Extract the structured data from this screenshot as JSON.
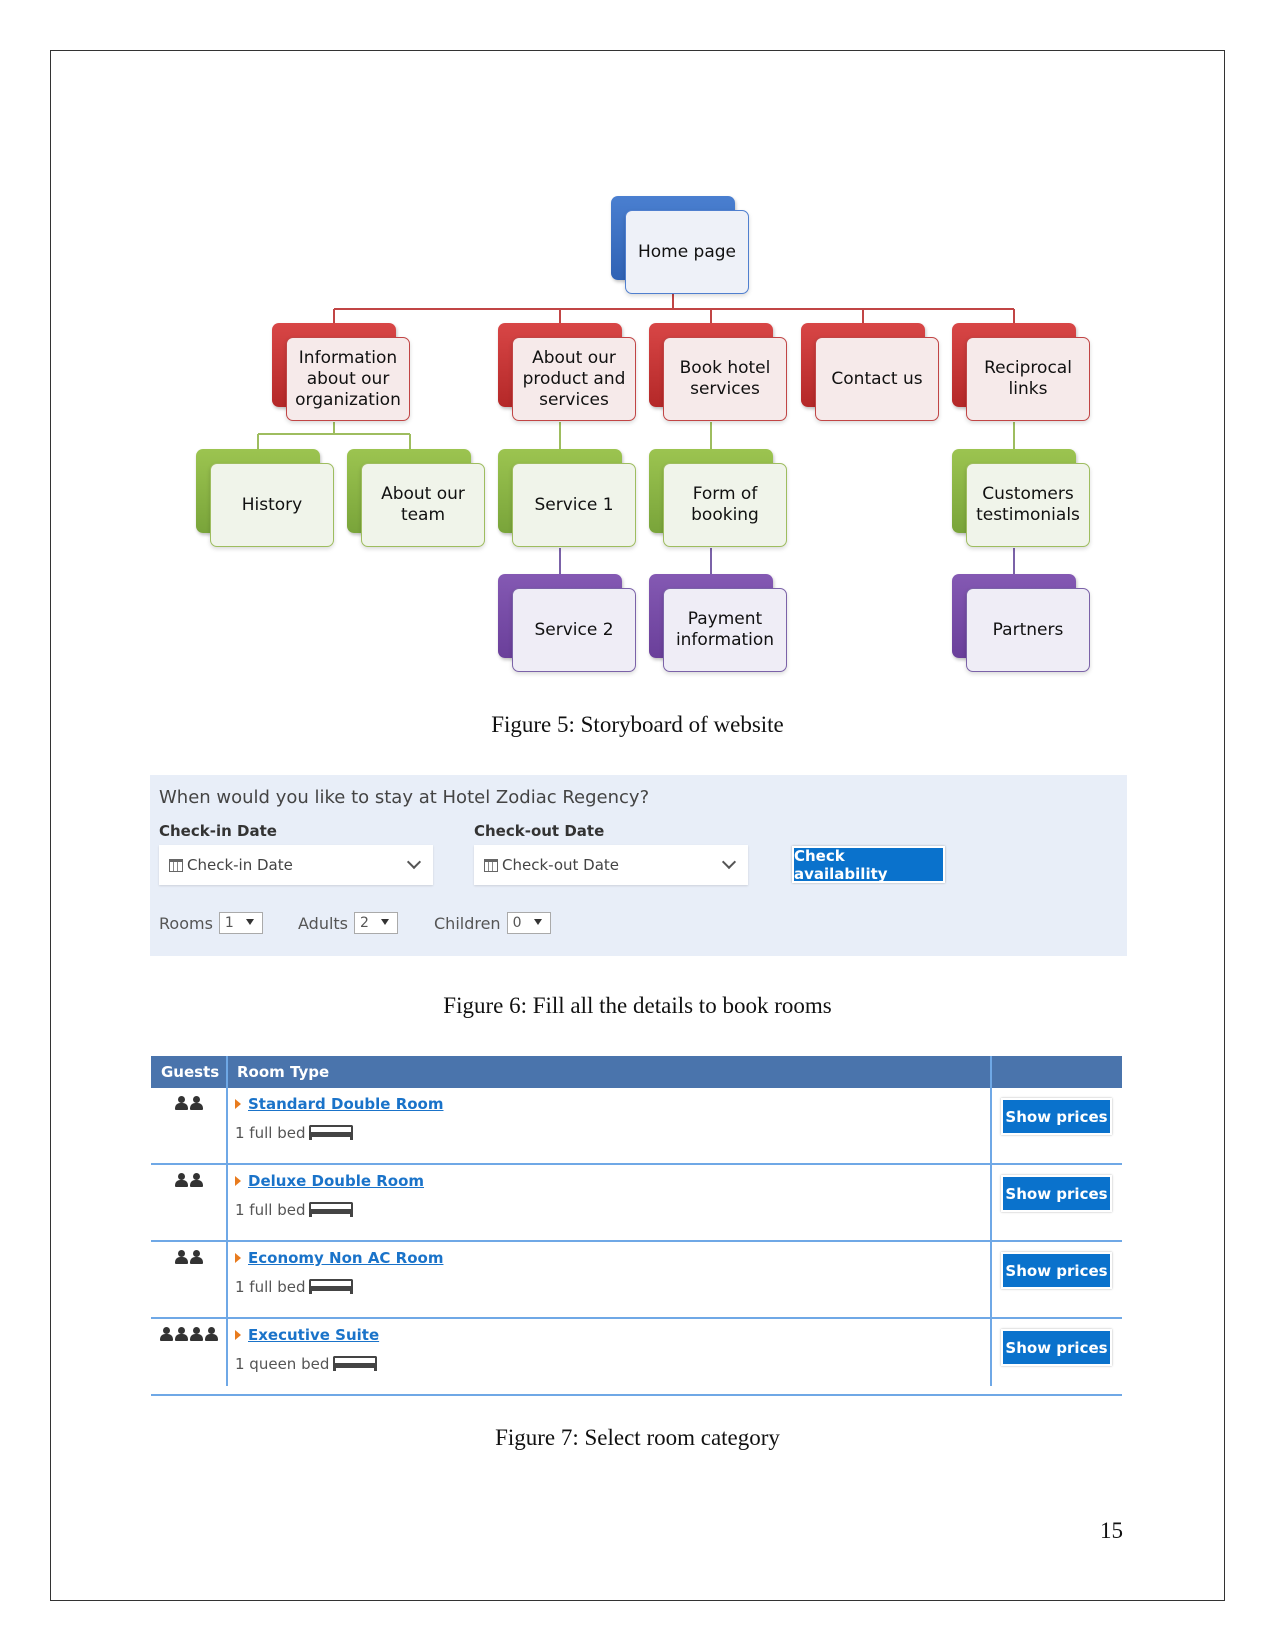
{
  "storyboard": {
    "nodes": {
      "home": "Home page",
      "info": "Information about our organization",
      "about_product": "About our product and services",
      "book": "Book hotel services",
      "contact": "Contact us",
      "reciprocal": "Reciprocal links",
      "history": "History",
      "about_team": "About our team",
      "service1": "Service 1",
      "form_booking": "Form of booking",
      "customers": "Customers testimonials",
      "service2": "Service 2",
      "payment": "Payment information",
      "partners": "Partners"
    },
    "colors": {
      "level1": "#3a6ec4",
      "level2": "#c73636",
      "level3": "#8bb445",
      "level4": "#7a4fab"
    }
  },
  "captions": {
    "fig5": "Figure 5: Storyboard of website",
    "fig6": "Figure 6: Fill all the details to book rooms",
    "fig7": "Figure 7: Select room category"
  },
  "booking": {
    "question": "When would you like to stay at Hotel Zodiac Regency?",
    "checkin_label": "Check-in Date",
    "checkin_placeholder": "Check-in Date",
    "checkout_label": "Check-out Date",
    "checkout_placeholder": "Check-out Date",
    "check_button": "Check availability",
    "rooms_label": "Rooms",
    "rooms_value": "1",
    "adults_label": "Adults",
    "adults_value": "2",
    "children_label": "Children",
    "children_value": "0",
    "accent": "#0a72cc"
  },
  "room_table": {
    "headers": {
      "guests": "Guests",
      "room_type": "Room Type",
      "action": ""
    },
    "rows": [
      {
        "guests": 2,
        "name": "Standard Double Room",
        "bed": "1 full bed",
        "button": "Show prices"
      },
      {
        "guests": 2,
        "name": "Deluxe Double Room",
        "bed": "1 full bed",
        "button": "Show prices"
      },
      {
        "guests": 2,
        "name": "Economy Non AC Room",
        "bed": "1 full bed",
        "button": "Show prices"
      },
      {
        "guests": 4,
        "name": "Executive Suite",
        "bed": "1 queen bed",
        "button": "Show prices"
      }
    ],
    "header_color": "#4a74ac",
    "link_color": "#1a73c9"
  },
  "page_number": "15"
}
